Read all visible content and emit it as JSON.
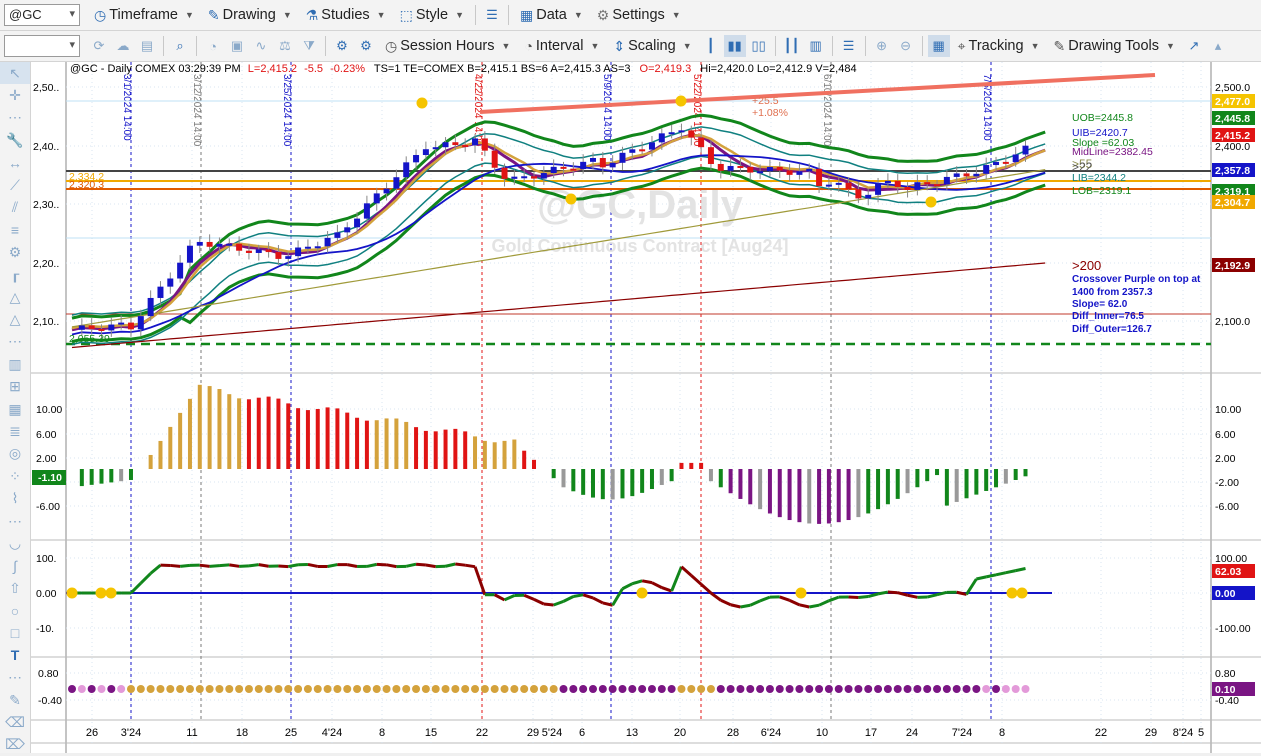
{
  "toolbar1": {
    "symbol": "@GC",
    "items": [
      {
        "label": "Timeframe",
        "icon": "clock-icon"
      },
      {
        "label": "Drawing",
        "icon": "pencil-icon"
      },
      {
        "label": "Studies",
        "icon": "flask-icon"
      },
      {
        "label": "Style",
        "icon": "style-icon"
      },
      {
        "label": "Data",
        "icon": "grid-icon"
      },
      {
        "label": "Settings",
        "icon": "gear-icon"
      }
    ]
  },
  "toolbar2": {
    "items": [
      {
        "label": "Session Hours",
        "icon": "session-icon"
      },
      {
        "label": "Interval",
        "icon": "interval-icon"
      },
      {
        "label": "Scaling",
        "icon": "scaling-icon"
      },
      {
        "label": "Tracking",
        "icon": "tracking-icon"
      },
      {
        "label": "Drawing Tools",
        "icon": "pencil-icon"
      }
    ]
  },
  "chart": {
    "header": {
      "symbol": "@GC - Daily  COMEX  03:29:39 PM",
      "last": "L=2,415.2",
      "chg": "-5.5",
      "pct": "-0.23%",
      "rest1": "TS=1  TE=COMEX  B=2,415.1  BS=6    A=2,415.3  AS=3",
      "open": "O=2,419.3",
      "rest2": "Hi=2,420.0  Lo=2,412.9  V=2,484"
    },
    "watermark": "@GC,Daily",
    "watermark_sub": "Gold Continuous Contract [Aug24]",
    "labels": {
      "uob": "UOB=2445.8",
      "uib": "UIB=2420.7",
      "slope": "Slope =62.03",
      "midline": "MidLine=2382.45",
      "gt55": ">55",
      "gt22": ">22",
      "lib": "LIB=2344.2",
      "lob": "LOB=2319.1",
      "gt200": ">200",
      "xover1": "Crossover Purple on top at",
      "xover2": "1400 from 2357.3",
      "xover3": "Slope= 62.0",
      "diff_inner": "Diff_Inner=76.5",
      "diff_outer": "Diff_Outer=126.7",
      "gain1": "+25.5",
      "gain2": "+1.08%",
      "lv1": "2,334.2",
      "lv2": "2,320.3",
      "lv3": "2,055.39"
    },
    "axis_price": [
      "2,500.0",
      "2,400.0",
      "2,300.0",
      "2,200.0",
      "2,100.0"
    ],
    "axis_price_left": [
      "2,50..",
      "2,40..",
      "2,30..",
      "2,20..",
      "2,10.."
    ],
    "price_badges": [
      "2,477.0",
      "2,445.8",
      "2,415.2",
      "2,357.8",
      "2,319.1",
      "2,304.7",
      "2,192.9"
    ],
    "axis_hist": [
      "10.00",
      "6.00",
      "2.00",
      "-2.00",
      "-6.00"
    ],
    "axis_hist_left": [
      "10.00",
      "6.00",
      "2.00",
      "-6.00"
    ],
    "hist_badge": "-1.10",
    "axis_osc": [
      "100.00",
      "0.00",
      "-100.00"
    ],
    "axis_osc_left": [
      "100.",
      "0.00",
      "-10."
    ],
    "osc_badges": [
      "62.03",
      "0.00"
    ],
    "axis_dots": [
      "0.80",
      "-0.40"
    ],
    "dots_badge": "0.10",
    "vlines": [
      "3/1/2024 14:00",
      "3/12/2024 14:00",
      "3/25/2024 14:00",
      "4/22/2024 14:00",
      "5/9/2024 14:00",
      "5/22/2024 14:00",
      "6/10/2024 14:00",
      "7/5/2024 14:00"
    ],
    "xaxis": [
      "26",
      "3'24",
      "11",
      "18",
      "25",
      "4'24",
      "8",
      "15",
      "22",
      "29",
      "5'24",
      "6",
      "13",
      "20",
      "28",
      "6'24",
      "10",
      "17",
      "24",
      "7'24",
      "8",
      "22",
      "29",
      "8'24",
      "5"
    ]
  },
  "colors": {
    "up": "#1414c8",
    "down": "#e01414",
    "green": "#11861b",
    "purple": "#7a1583",
    "gold": "#d4a23c"
  }
}
